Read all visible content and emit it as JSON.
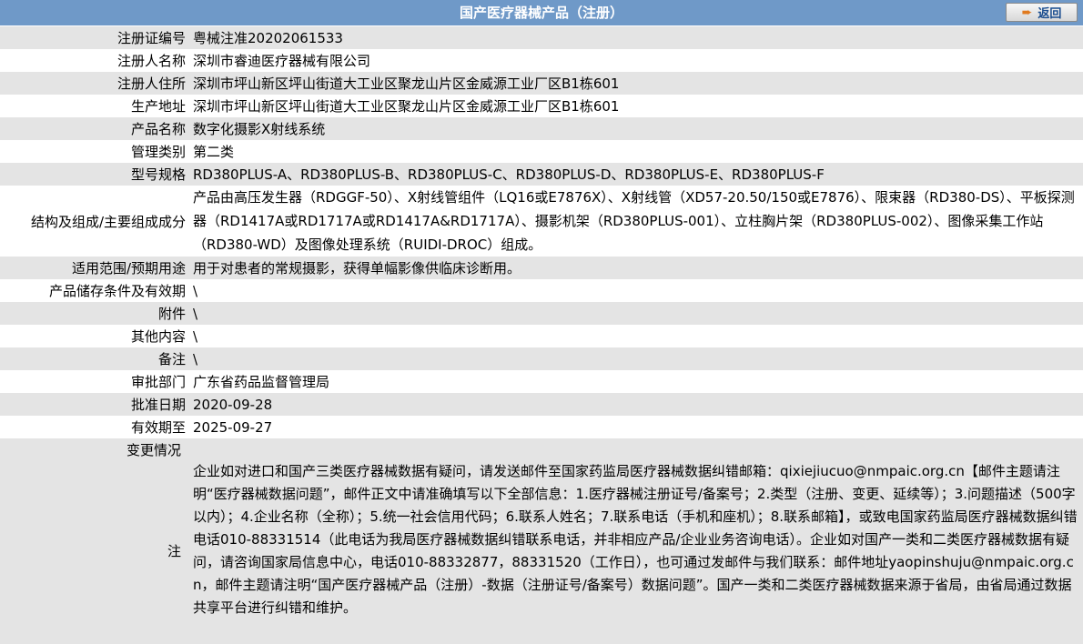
{
  "header": {
    "title": "国产医疗器械产品（注册）",
    "back_label": "返回"
  },
  "rows": [
    {
      "label": "注册证编号",
      "value": "粤械注准20202061533"
    },
    {
      "label": "注册人名称",
      "value": "深圳市睿迪医疗器械有限公司"
    },
    {
      "label": "注册人住所",
      "value": "深圳市坪山新区坪山街道大工业区聚龙山片区金威源工业厂区B1栋601"
    },
    {
      "label": "生产地址",
      "value": "深圳市坪山新区坪山街道大工业区聚龙山片区金威源工业厂区B1栋601"
    },
    {
      "label": "产品名称",
      "value": "数字化摄影X射线系统"
    },
    {
      "label": "管理类别",
      "value": "第二类"
    },
    {
      "label": "型号规格",
      "value": "RD380PLUS-A、RD380PLUS-B、RD380PLUS-C、RD380PLUS-D、RD380PLUS-E、RD380PLUS-F"
    },
    {
      "label": "结构及组成/主要组成成分",
      "value": "产品由高压发生器（RDGGF-50）、X射线管组件（LQ16或E7876X）、X射线管（XD57-20.50/150或E7876）、限束器（RD380-DS）、平板探测器（RD1417A或RD1717A或RD1417A&RD1717A）、摄影机架（RD380PLUS-001）、立柱胸片架（RD380PLUS-002）、图像采集工作站（RD380-WD）及图像处理系统（RUIDI-DROC）组成。"
    },
    {
      "label": "适用范围/预期用途",
      "value": "用于对患者的常规摄影，获得单幅影像供临床诊断用。"
    },
    {
      "label": "产品储存条件及有效期",
      "value": "\\"
    },
    {
      "label": "附件",
      "value": "\\"
    },
    {
      "label": "其他内容",
      "value": "\\"
    },
    {
      "label": "备注",
      "value": "\\"
    },
    {
      "label": "审批部门",
      "value": "广东省药品监督管理局"
    },
    {
      "label": "批准日期",
      "value": "2020-09-28"
    },
    {
      "label": "有效期至",
      "value": "2025-09-27"
    },
    {
      "label": "变更情况",
      "value": ""
    }
  ],
  "note": {
    "label": "注",
    "text": "企业如对进口和国产三类医疗器械数据有疑问，请发送邮件至国家药监局医疗器械数据纠错邮箱：qixiejiucuo@nmpaic.org.cn【邮件主题请注明“医疗器械数据问题”，邮件正文中请准确填写以下全部信息：1.医疗器械注册证号/备案号；2.类型（注册、变更、延续等）；3.问题描述（500字以内）；4.企业名称（全称）；5.统一社会信用代码；6.联系人姓名；7.联系电话（手机和座机）；8.联系邮箱】，或致电国家药监局医疗器械数据纠错电话010-88331514（此电话为我局医疗器械数据纠错联系电话，并非相应产品/企业业务咨询电话）。企业如对国产一类和二类医疗器械数据有疑问，请咨询国家局信息中心，电话010-88332877，88331520（工作日），也可通过发邮件与我们联系：邮件地址yaopinshuju@nmpaic.org.cn，邮件主题请注明“国产医疗器械产品（注册）-数据（注册证号/备案号）数据问题”。国产一类和二类医疗器械数据来源于省局，由省局通过数据共享平台进行纠错和维护。"
  }
}
